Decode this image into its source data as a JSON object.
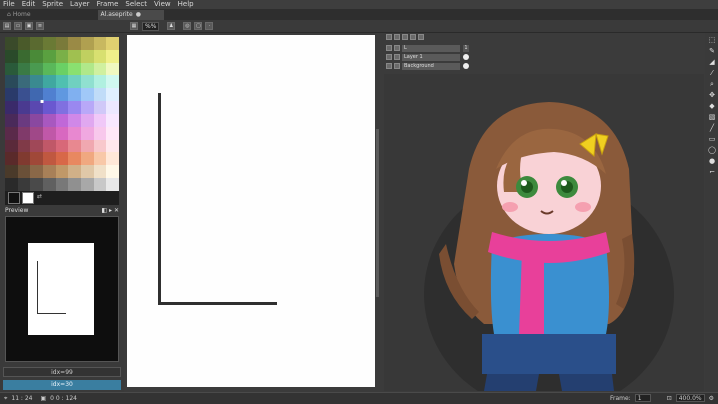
{
  "app": {
    "menu": [
      "File",
      "Edit",
      "Sprite",
      "Layer",
      "Frame",
      "Select",
      "View",
      "Help"
    ],
    "tabs": [
      {
        "label": "Home",
        "active": false
      },
      {
        "label": "Al.aseprite",
        "active": true,
        "close": "●"
      }
    ]
  },
  "toolbar": {
    "zoom_value": "%%",
    "icons": [
      "new-file-icon",
      "open-icon",
      "save-icon",
      "list-icon",
      "grid-icon",
      "brush-icon",
      "sprite-icon"
    ]
  },
  "palette": {
    "colors": [
      "#3a4a2a",
      "#4a5a2a",
      "#5a6a30",
      "#6a7a35",
      "#7a7a3a",
      "#9a8a45",
      "#b0a050",
      "#c8b860",
      "#e0d070",
      "#2a4a2a",
      "#3a6a30",
      "#4a8a38",
      "#5aa040",
      "#7ab048",
      "#a0c050",
      "#c0d060",
      "#d8e070",
      "#f0f08a",
      "#2a5a3a",
      "#3a7a45",
      "#4a9a50",
      "#5ab85a",
      "#6ad065",
      "#8ae070",
      "#b0e88a",
      "#d0f0a0",
      "#f0f8c0",
      "#2a4a5a",
      "#3a6a7a",
      "#3a8a90",
      "#40a8a0",
      "#50c0b0",
      "#70d0c0",
      "#90e0d0",
      "#b0f0e0",
      "#d0f8f0",
      "#2a3a6a",
      "#3a5090",
      "#4068b0",
      "#5080d0",
      "#6098e0",
      "#80b0f0",
      "#a0c8f8",
      "#c0dcf8",
      "#e0f0ff",
      "#3a2a6a",
      "#4a3a90",
      "#5a48b0",
      "#6a58d0",
      "#8070e0",
      "#9a88f0",
      "#b8a8f8",
      "#d0c8f8",
      "#ece8ff",
      "#4a2a5a",
      "#6a3a80",
      "#8a48a0",
      "#a858c0",
      "#c068d8",
      "#d088e8",
      "#e0a8f0",
      "#f0c8f8",
      "#f8e8ff",
      "#5a2a4a",
      "#803a6a",
      "#a04888",
      "#c058a8",
      "#d868c0",
      "#e888d0",
      "#f0a8e0",
      "#f8c8ec",
      "#ffe8f8",
      "#5a2a3a",
      "#803a48",
      "#a04858",
      "#c05868",
      "#d86878",
      "#e88890",
      "#f0a8b0",
      "#f8c8cc",
      "#ffe8ec",
      "#5a2a2a",
      "#803a30",
      "#a04838",
      "#c05840",
      "#d86848",
      "#e88860",
      "#f0a880",
      "#f8c8a8",
      "#ffe8d8",
      "#4a3a2a",
      "#6a5038",
      "#8a6848",
      "#a88058",
      "#c09868",
      "#d0b088",
      "#e0c8a8",
      "#f0e0c8",
      "#fff8e8",
      "#2a2a2a",
      "#3a3a3a",
      "#4a4a4a",
      "#606060",
      "#787878",
      "#909090",
      "#a8a8a8",
      "#c8c8c8",
      "#e8e8e8"
    ]
  },
  "preview": {
    "title": "Preview",
    "controls": "◧ ▸ ✕"
  },
  "index_buttons": [
    "idx=99",
    "idx=30"
  ],
  "layers": [
    {
      "name": "L",
      "num": "1"
    },
    {
      "name": "Layer 1",
      "num": ""
    },
    {
      "name": "Background",
      "num": ""
    }
  ],
  "status": {
    "cursor_pos": "11 : 24",
    "sprite_size": "0 0 : 124",
    "frame_label": "Frame:",
    "frame_value": "1",
    "zoom_percent": "400.0%"
  }
}
